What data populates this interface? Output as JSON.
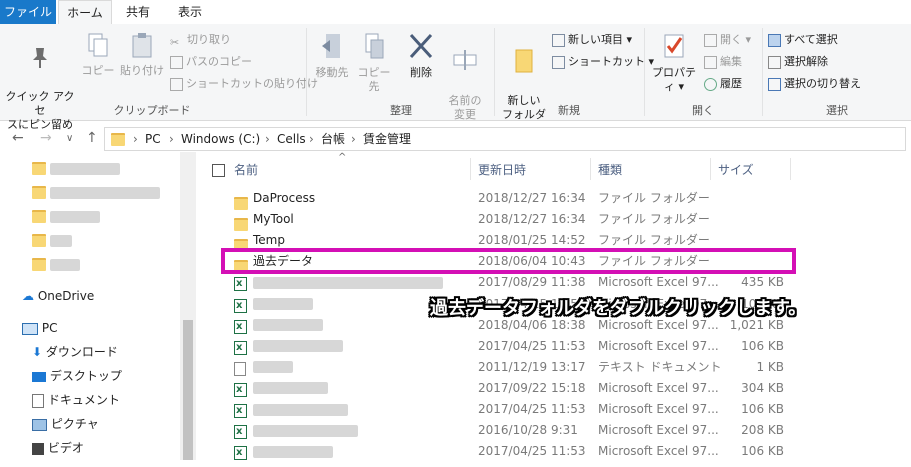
{
  "menu": {
    "file": "ファイル",
    "home": "ホーム",
    "share": "共有",
    "view": "表示"
  },
  "ribbon": {
    "clipboard": {
      "pin": "クイック アクセ\nスにピン留め",
      "copy": "コピー",
      "paste": "貼り付け",
      "cut": "切り取り",
      "copy_path": "パスのコピー",
      "paste_shortcut": "ショートカットの貼り付け",
      "label": "クリップボード"
    },
    "organize": {
      "move": "移動先",
      "copy_to": "コピー先",
      "delete": "削除",
      "rename": "名前の\n変更",
      "label": "整理"
    },
    "new": {
      "new_folder": "新しい\nフォルダー",
      "new_item": "新しい項目",
      "shortcut": "ショートカット",
      "label": "新規"
    },
    "open": {
      "properties": "プロパティ",
      "open": "開く",
      "edit": "編集",
      "history": "履歴",
      "label": "開く"
    },
    "select": {
      "select_all": "すべて選択",
      "select_none": "選択解除",
      "invert": "選択の切り替え",
      "label": "選択"
    }
  },
  "address": {
    "crumbs": [
      "PC",
      "Windows (C:)",
      "Cells",
      "台帳",
      "賃金管理"
    ]
  },
  "nav": {
    "onedrive": "OneDrive",
    "pc": "PC",
    "downloads": "ダウンロード",
    "desktop": "デスクトップ",
    "documents": "ドキュメント",
    "pictures": "ピクチャ",
    "videos": "ビデオ"
  },
  "columns": {
    "name": "名前",
    "date": "更新日時",
    "type": "種類",
    "size": "サイズ"
  },
  "rows": [
    {
      "name": "DaProcess",
      "date": "2018/12/27 16:34",
      "type": "ファイル フォルダー",
      "size": ""
    },
    {
      "name": "MyTool",
      "date": "2018/12/27 16:34",
      "type": "ファイル フォルダー",
      "size": ""
    },
    {
      "name": "Temp",
      "date": "2018/01/25 14:52",
      "type": "ファイル フォルダー",
      "size": ""
    },
    {
      "name": "過去データ",
      "date": "2018/06/04 10:43",
      "type": "ファイル フォルダー",
      "size": ""
    },
    {
      "name": "",
      "date": "2017/08/29 11:38",
      "type": "Microsoft Excel 97...",
      "size": "435 KB"
    },
    {
      "name": "",
      "date": "2017/04/25 11:53",
      "type": "Microsoft Excel 97...",
      "size": "106 KB"
    },
    {
      "name": "",
      "date": "2018/04/06 18:38",
      "type": "Microsoft Excel 97...",
      "size": "1,021 KB"
    },
    {
      "name": "",
      "date": "2017/04/25 11:53",
      "type": "Microsoft Excel 97...",
      "size": "106 KB"
    },
    {
      "name": "",
      "date": "2011/12/19 13:17",
      "type": "テキスト ドキュメント",
      "size": "1 KB"
    },
    {
      "name": "",
      "date": "2017/09/22 15:18",
      "type": "Microsoft Excel 97...",
      "size": "304 KB"
    },
    {
      "name": "",
      "date": "2017/04/25 11:53",
      "type": "Microsoft Excel 97...",
      "size": "106 KB"
    },
    {
      "name": "",
      "date": "2016/10/28 9:31",
      "type": "Microsoft Excel 97...",
      "size": "208 KB"
    },
    {
      "name": "",
      "date": "2017/04/25 11:53",
      "type": "Microsoft Excel 97...",
      "size": "106 KB"
    }
  ],
  "callout": "過去データフォルダをダブルクリックします。"
}
